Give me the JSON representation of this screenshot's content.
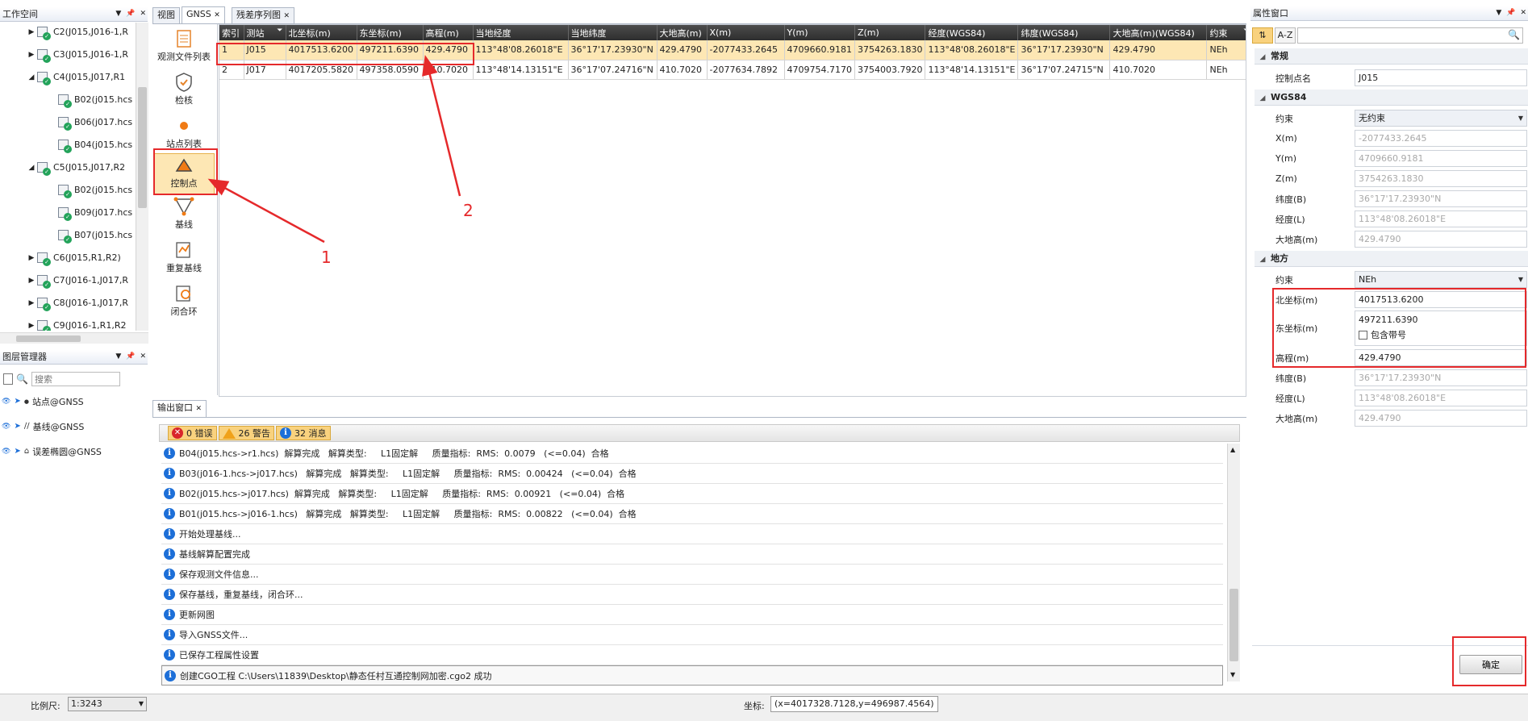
{
  "workspace": {
    "title": "工作空间",
    "tree": [
      {
        "label": "C2(J015,J016-1,R",
        "expand": "▶",
        "level": 0
      },
      {
        "label": "C3(J015,J016-1,R",
        "expand": "▶",
        "level": 0
      },
      {
        "label": "C4(J015,J017,R1",
        "expand": "◢",
        "level": 0
      },
      {
        "label": "B02(j015.hcs",
        "expand": "",
        "level": 1
      },
      {
        "label": "B06(j017.hcs",
        "expand": "",
        "level": 1
      },
      {
        "label": "B04(j015.hcs",
        "expand": "",
        "level": 1
      },
      {
        "label": "C5(J015,J017,R2",
        "expand": "◢",
        "level": 0
      },
      {
        "label": "B02(j015.hcs",
        "expand": "",
        "level": 1
      },
      {
        "label": "B09(j017.hcs",
        "expand": "",
        "level": 1
      },
      {
        "label": "B07(j015.hcs",
        "expand": "",
        "level": 1
      },
      {
        "label": "C6(J015,R1,R2)",
        "expand": "▶",
        "level": 0
      },
      {
        "label": "C7(J016-1,J017,R",
        "expand": "▶",
        "level": 0
      },
      {
        "label": "C8(J016-1,J017,R",
        "expand": "▶",
        "level": 0
      },
      {
        "label": "C9(J016-1,R1,R2",
        "expand": "▶",
        "level": 0
      }
    ]
  },
  "layers": {
    "title": "图层管理器",
    "search_placeholder": "搜索",
    "items": [
      "站点@GNSS",
      "基线@GNSS",
      "误差椭圆@GNSS"
    ]
  },
  "tabs": [
    "视图",
    "GNSS",
    "残差序列图"
  ],
  "gnss_nav": [
    "观测文件列表",
    "检核",
    "站点列表",
    "控制点",
    "基线",
    "重复基线",
    "闭合环"
  ],
  "grid": {
    "columns": [
      "索引",
      "测站",
      "北坐标(m)",
      "东坐标(m)",
      "高程(m)",
      "当地经度",
      "当地纬度",
      "大地高(m)",
      "X(m)",
      "Y(m)",
      "Z(m)",
      "经度(WGS84)",
      "纬度(WGS84)",
      "大地高(m)(WGS84)",
      "约束"
    ],
    "rows": [
      [
        "1",
        "J015",
        "4017513.6200",
        "497211.6390",
        "429.4790",
        "113°48'08.26018\"E",
        "36°17'17.23930\"N",
        "429.4790",
        "-2077433.2645",
        "4709660.9181",
        "3754263.1830",
        "113°48'08.26018\"E",
        "36°17'17.23930\"N",
        "429.4790",
        "NEh"
      ],
      [
        "2",
        "J017",
        "4017205.5820",
        "497358.0590",
        "410.7020",
        "113°48'14.13151\"E",
        "36°17'07.24716\"N",
        "410.7020",
        "-2077634.7892",
        "4709754.7170",
        "3754003.7920",
        "113°48'14.13151\"E",
        "36°17'07.24715\"N",
        "410.7020",
        "NEh"
      ]
    ]
  },
  "annotations": {
    "label1": "1",
    "label2": "2"
  },
  "output": {
    "title": "输出窗口",
    "errors": "0 错误",
    "warnings": "26 警告",
    "messages_count": "32 消息",
    "messages": [
      "B04(j015.hcs->r1.hcs)  解算完成   解算类型:     L1固定解     质量指标:  RMS:  0.0079   (<=0.04)  合格",
      "B03(j016-1.hcs->j017.hcs)   解算完成   解算类型:     L1固定解     质量指标:  RMS:  0.00424   (<=0.04)  合格",
      "B02(j015.hcs->j017.hcs)  解算完成   解算类型:     L1固定解     质量指标:  RMS:  0.00921   (<=0.04)  合格",
      "B01(j015.hcs->j016-1.hcs)   解算完成   解算类型:     L1固定解     质量指标:  RMS:  0.00822   (<=0.04)  合格",
      "开始处理基线...",
      "基线解算配置完成",
      "保存观测文件信息...",
      "保存基线，重复基线，闭合环...",
      "更新网图",
      "导入GNSS文件...",
      "已保存工程属性设置",
      "创建CGO工程 C:\\Users\\11839\\Desktop\\静态任村互通控制网加密.cgo2 成功"
    ]
  },
  "properties": {
    "title": "属性窗口",
    "sort_cat": "⇅",
    "sort_az": "A-Z",
    "sections": {
      "general": "常规",
      "wgs84": "WGS84",
      "local": "地方"
    },
    "general": {
      "name_label": "控制点名",
      "name_value": "J015"
    },
    "wgs84": [
      [
        "约束",
        "无约束"
      ],
      [
        "X(m)",
        "-2077433.2645"
      ],
      [
        "Y(m)",
        "4709660.9181"
      ],
      [
        "Z(m)",
        "3754263.1830"
      ],
      [
        "纬度(B)",
        "36°17'17.23930\"N"
      ],
      [
        "经度(L)",
        "113°48'08.26018\"E"
      ],
      [
        "大地高(m)",
        "429.4790"
      ]
    ],
    "local": {
      "constraint_label": "约束",
      "constraint_value": "NEh",
      "north_label": "北坐标(m)",
      "north_value": "4017513.6200",
      "east_label": "东坐标(m)",
      "east_value": "497211.6390",
      "zone_label": "包含带号",
      "height_label": "高程(m)",
      "height_value": "429.4790",
      "extra": [
        [
          "纬度(B)",
          "36°17'17.23930\"N"
        ],
        [
          "经度(L)",
          "113°48'08.26018\"E"
        ],
        [
          "大地高(m)",
          "429.4790"
        ]
      ]
    },
    "ok_button": "确定"
  },
  "status": {
    "scale_label": "比例尺:",
    "scale_value": "1:3243",
    "coord_label": "坐标:",
    "coord_value": "(x=4017328.7128,y=496987.4564)"
  },
  "colors": {
    "accent_red": "#e5292b",
    "selected_row": "#fde7b4",
    "header_dark": "#3a3a3a",
    "info_blue": "#1d6fd8"
  }
}
